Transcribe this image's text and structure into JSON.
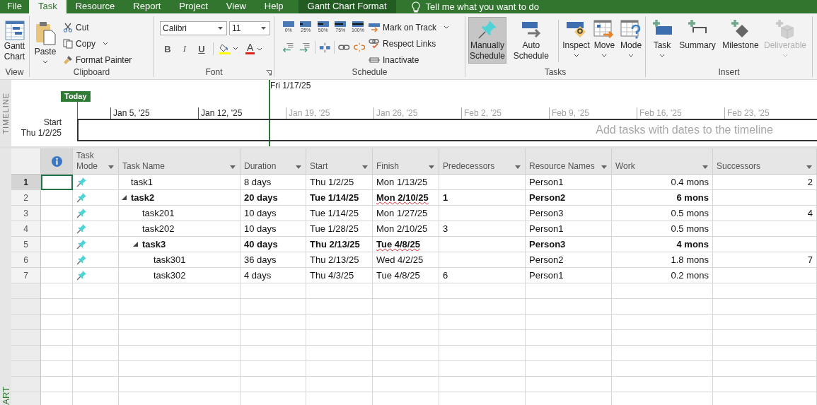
{
  "tabs": [
    {
      "label": "File",
      "selected": false,
      "kind": "plain"
    },
    {
      "label": "Task",
      "selected": true,
      "kind": "plain"
    },
    {
      "label": "Resource",
      "selected": false,
      "kind": "plain"
    },
    {
      "label": "Report",
      "selected": false,
      "kind": "plain"
    },
    {
      "label": "Project",
      "selected": false,
      "kind": "plain"
    },
    {
      "label": "View",
      "selected": false,
      "kind": "plain"
    },
    {
      "label": "Help",
      "selected": false,
      "kind": "plain"
    },
    {
      "label": "Gantt Chart Format",
      "selected": false,
      "kind": "contextual"
    }
  ],
  "tell_me": "Tell me what you want to do",
  "ribbon": {
    "view": {
      "label": "View",
      "button": "Gantt Chart"
    },
    "clipboard": {
      "label": "Clipboard",
      "paste": "Paste",
      "cut": "Cut",
      "copy": "Copy",
      "format_painter": "Format Painter"
    },
    "font": {
      "label": "Font",
      "font_name": "Calibri",
      "font_size": "11",
      "bold": "B",
      "italic": "I",
      "underline": "U",
      "font_color": "A"
    },
    "schedule": {
      "label": "Schedule",
      "percent": [
        {
          "label": "0%"
        },
        {
          "label": "25%"
        },
        {
          "label": "50%"
        },
        {
          "label": "75%"
        },
        {
          "label": "100%"
        }
      ],
      "mark_on_track": "Mark on Track",
      "respect_links": "Respect Links",
      "inactivate": "Inactivate"
    },
    "tasks": {
      "label": "Tasks",
      "modes": [
        {
          "label": "Manually Schedule",
          "kind": "manual",
          "selected": true
        },
        {
          "label": "Auto Schedule",
          "kind": "auto",
          "selected": false
        }
      ],
      "tools": [
        {
          "label": "Inspect",
          "kind": "inspect"
        },
        {
          "label": "Move",
          "kind": "move"
        },
        {
          "label": "Mode",
          "kind": "mode"
        }
      ]
    },
    "insert": {
      "label": "Insert",
      "items": [
        {
          "label": "Task",
          "kind": "task",
          "disabled": false,
          "has_menu": true
        },
        {
          "label": "Summary",
          "kind": "summary",
          "disabled": false,
          "has_menu": false
        },
        {
          "label": "Milestone",
          "kind": "milestone",
          "disabled": false,
          "has_menu": false
        },
        {
          "label": "Deliverable",
          "kind": "deliverable",
          "disabled": true,
          "has_menu": true
        }
      ]
    }
  },
  "timeline": {
    "side_label": "TIMELINE",
    "today": "Today",
    "current_date": "Fri 1/17/25",
    "ticks": [
      {
        "label": "Jan 5, '25",
        "dimmed": false
      },
      {
        "label": "Jan 12, '25",
        "dimmed": false
      },
      {
        "label": "Jan 19, '25",
        "dimmed": true
      },
      {
        "label": "Jan 26, '25",
        "dimmed": true
      },
      {
        "label": "Feb 2, '25",
        "dimmed": true
      },
      {
        "label": "Feb 9, '25",
        "dimmed": true
      },
      {
        "label": "Feb 16, '25",
        "dimmed": true
      },
      {
        "label": "Feb 23, '25",
        "dimmed": true
      }
    ],
    "start_label": "Start",
    "start_date": "Thu 1/2/25",
    "placeholder": "Add tasks with dates to the timeline"
  },
  "view_bar_label": "ART",
  "table": {
    "columns": [
      {
        "kind": "info"
      },
      {
        "label": "Task Mode",
        "kind": "text"
      },
      {
        "label": "Task Name",
        "kind": "text"
      },
      {
        "label": "Duration",
        "kind": "text"
      },
      {
        "label": "Start",
        "kind": "text"
      },
      {
        "label": "Finish",
        "kind": "text"
      },
      {
        "label": "Predecessors",
        "kind": "text"
      },
      {
        "label": "Resource Names",
        "kind": "text"
      },
      {
        "label": "Work",
        "kind": "text"
      },
      {
        "label": "Successors",
        "kind": "text"
      }
    ],
    "rows": [
      {
        "id": "1",
        "name": "task1",
        "duration": "8 days",
        "start": "Thu 1/2/25",
        "finish": "Mon 1/13/25",
        "finish_flagged": false,
        "resources": "Person1",
        "work": "0.4 mons",
        "successors": "2",
        "selected": true
      },
      {
        "id": "2",
        "name": "task2",
        "duration": "20 days",
        "start": "Tue 1/14/25",
        "finish": "Mon 2/10/25",
        "finish_flagged": true,
        "predecessors": "1",
        "resources": "Person2",
        "work": "6 mons",
        "selected": false,
        "expanded": true,
        "children": [
          {
            "id": "3",
            "name": "task201",
            "duration": "10 days",
            "start": "Tue 1/14/25",
            "finish": "Mon 1/27/25",
            "finish_flagged": false,
            "resources": "Person3",
            "work": "0.5 mons",
            "successors": "4",
            "selected": false
          },
          {
            "id": "4",
            "name": "task202",
            "duration": "10 days",
            "start": "Tue 1/28/25",
            "finish": "Mon 2/10/25",
            "finish_flagged": false,
            "predecessors": "3",
            "resources": "Person1",
            "work": "0.5 mons",
            "selected": false
          },
          {
            "id": "5",
            "name": "task3",
            "duration": "40 days",
            "start": "Thu 2/13/25",
            "finish": "Tue 4/8/25",
            "finish_flagged": true,
            "resources": "Person3",
            "work": "4 mons",
            "selected": false,
            "expanded": true,
            "children": [
              {
                "id": "6",
                "name": "task301",
                "duration": "36 days",
                "start": "Thu 2/13/25",
                "finish": "Wed 4/2/25",
                "finish_flagged": false,
                "resources": "Person2",
                "work": "1.8 mons",
                "successors": "7",
                "selected": false
              },
              {
                "id": "7",
                "name": "task302",
                "duration": "4 days",
                "start": "Thu 4/3/25",
                "finish": "Tue 4/8/25",
                "finish_flagged": false,
                "predecessors": "6",
                "resources": "Person1",
                "work": "0.2 mons",
                "selected": false
              }
            ]
          }
        ]
      }
    ]
  }
}
